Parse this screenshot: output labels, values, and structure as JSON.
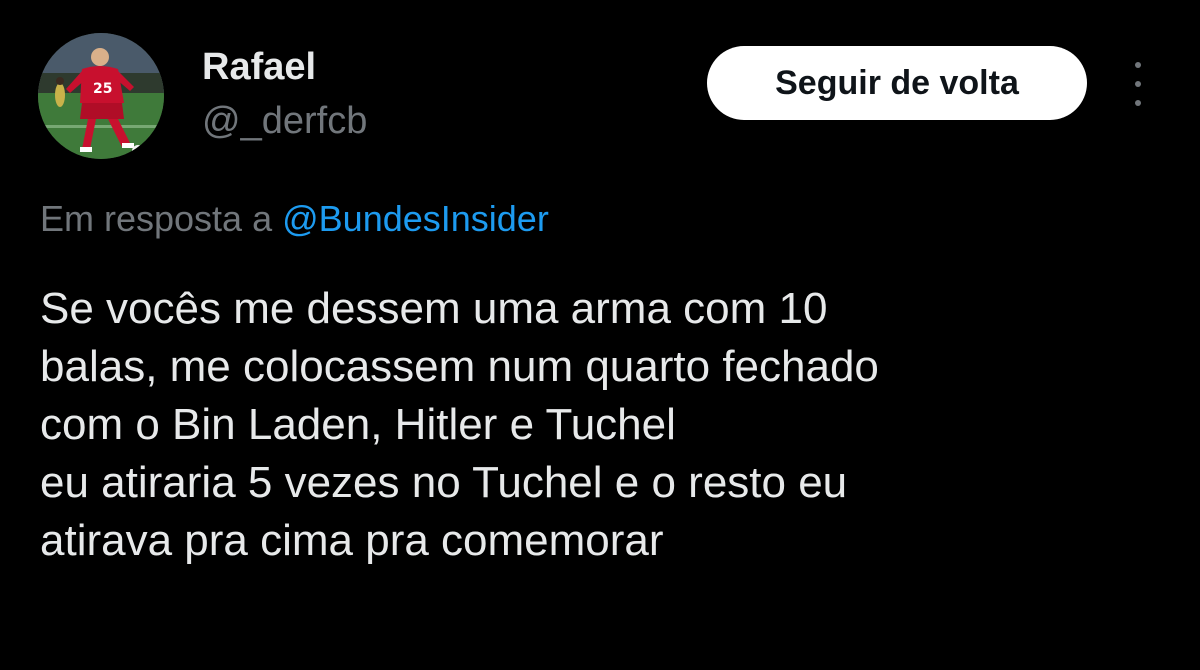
{
  "user": {
    "display_name": "Rafael",
    "handle": "@_derfcb",
    "avatar_icon": "player-photo-avatar",
    "avatar_jersey_number": "25"
  },
  "actions": {
    "follow_label": "Seguir de volta",
    "more_icon": "more-vertical-icon"
  },
  "reply_context": {
    "prefix": "Em resposta a",
    "mention": "@BundesInsider"
  },
  "tweet": {
    "lines": [
      "Se vocês me dessem uma arma com 10",
      "balas, me colocassem num quarto fechado",
      "com o Bin Laden, Hitler e Tuchel",
      "eu atiraria 5 vezes no Tuchel e o resto eu",
      "atirava pra cima pra comemorar"
    ]
  },
  "colors": {
    "background": "#000000",
    "primary_text": "#e7e9ea",
    "secondary_text": "#71767b",
    "accent": "#1d9bf0",
    "button_bg": "#ffffff"
  }
}
